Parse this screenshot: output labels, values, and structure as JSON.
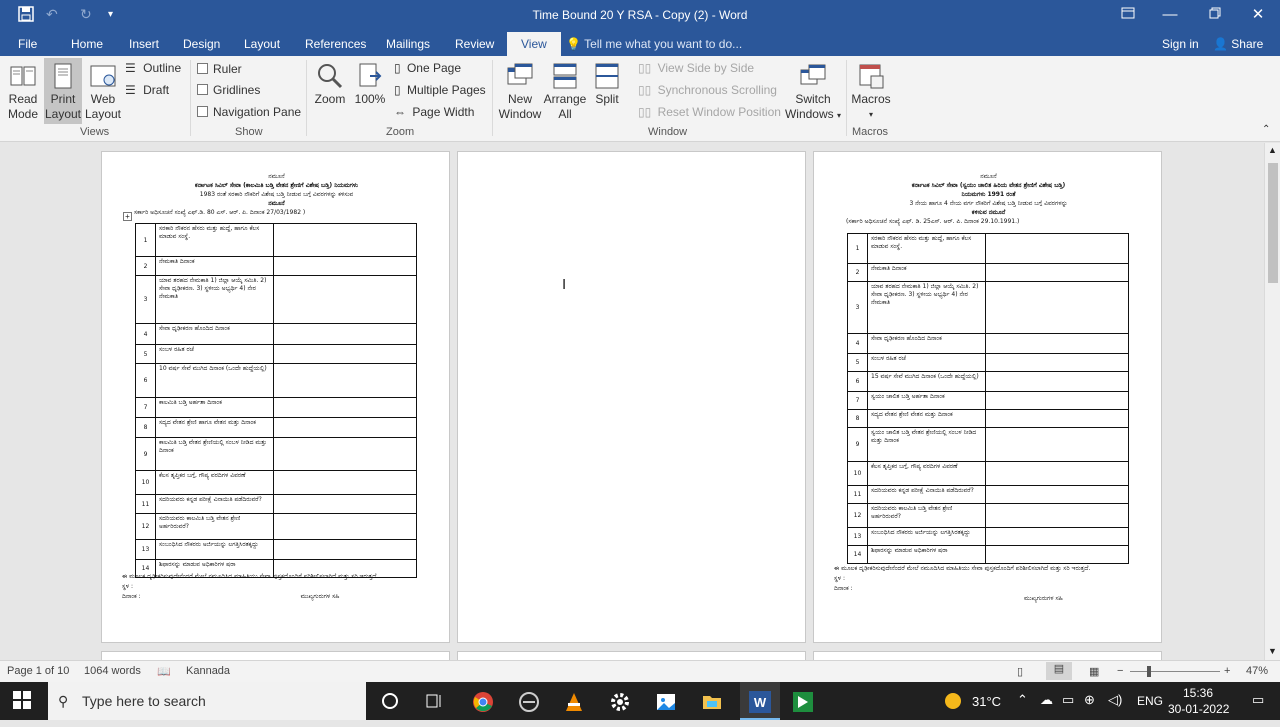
{
  "window": {
    "title": "Time Bound  20 Y RSA - Copy (2) - Word",
    "controls": [
      "restore-ribbon",
      "minimize",
      "maximize",
      "close"
    ]
  },
  "tabs": [
    "File",
    "Home",
    "Insert",
    "Design",
    "Layout",
    "References",
    "Mailings",
    "Review",
    "View"
  ],
  "active_tab": "View",
  "tell_me": "Tell me what you want to do...",
  "signin": "Sign in",
  "share": "Share",
  "ribbon": {
    "views": {
      "read_mode": [
        "Read",
        "Mode"
      ],
      "print_layout": [
        "Print",
        "Layout"
      ],
      "web_layout": [
        "Web",
        "Layout"
      ],
      "outline": "Outline",
      "draft": "Draft",
      "group": "Views"
    },
    "show": {
      "ruler": "Ruler",
      "gridlines": "Gridlines",
      "nav_pane": "Navigation Pane",
      "group": "Show"
    },
    "zoom": {
      "zoom": "Zoom",
      "pct": "100%",
      "one_page": "One Page",
      "multiple_pages": "Multiple Pages",
      "page_width": "Page Width",
      "group": "Zoom"
    },
    "window": {
      "new_window": [
        "New",
        "Window"
      ],
      "arrange_all": [
        "Arrange",
        "All"
      ],
      "split": "Split",
      "side_by_side": "View Side by Side",
      "sync_scroll": "Synchronous Scrolling",
      "reset_pos": "Reset Window Position",
      "switch_windows": [
        "Switch",
        "Windows"
      ],
      "group": "Window"
    },
    "macros": {
      "label": "Macros",
      "group": "Macros"
    }
  },
  "page1": {
    "lines": [
      "ನಮೂನೆ",
      "ಕರ್ನಾಟಕ ಸಿವಿಲ್ ಸೇವಾ (ಕಾಲಮಿತಿ ಬಡ್ತಿ ವೇತನ ಶ್ರೇಣಿಗೆ ವಿಶೇಷ ಬಡ್ತಿ) ನಿಯಮಗಳು",
      "1983 ರಂತೆ ಸರಕಾರಿ ನೌಕರಿಗೆ ವಿಶೇಷ ಬಡ್ತಿ ನೀಡುವ ಬಗ್ಗೆ ವಿವರಗಳನ್ನು ಕಳಿಸುವ",
      "ನಮೂನೆ",
      "ಸರ್ಕಾರಿ ಅಧಿಸೂಚನೆ ಸಂಖ್ಯೆ ಎಫ್.ಡಿ. 80 ಎಸ್. ಆರ್. ಪಿ. ದಿನಾಂಕ 27/03/1982 )"
    ],
    "rows": [
      "ಸರಕಾರಿ ನೌಕರನ ಹೆಸರು ಮತ್ತು ಹುದ್ದೆ, ಹಾಗೂ ಕೆಲಸ ಮಾಡುವ ಸಂಸ್ಥೆ.",
      "ನೇಮಕಾತಿ ದಿನಾಂಕ",
      "ಯಾವ ತರಹದ ನೇಮಕಾತಿ 1) ಜಿಲ್ಲಾ ಆಯ್ಕೆ ಸಮಿತಿ. 2) ಸೇವಾ ಧೃಢೀಕರಣ. 3) ಸ್ಥಳೀಯ ಅಭ್ಯರ್ಥಿ 4) ನೇರ ನೇಮಕಾತಿ",
      "ಸೇವಾ ಧೃಢೀಕರಣ ಹೊಂದಿದ ದಿನಾಂಕ",
      "ಸಂಬಳ ರಹಿತ ರಜೆ",
      "10 ವರ್ಷ ಸೇವೆ ಮುಗಿದ ದಿನಾಂಕ (ಒಂದೇ ಹುದ್ದೆಯಲ್ಲಿ)",
      "ಕಾಲಮಿತಿ ಬಡ್ತಿ ಅರ್ಹತಾ ದಿನಾಂಕ",
      "ಸದ್ಯದ ವೇತನ ಶ್ರೇಣಿ ಹಾಗೂ ವೇತನ ಮತ್ತು ದಿನಾಂಕ",
      "ಕಾಲಮಿತಿ ಬಡ್ತಿ ವೇತನ ಶ್ರೇಣಿಯಲ್ಲಿ ಸಂಬಳ ನೀಡಿದ ಮತ್ತು ದಿನಾಂಕ",
      "ಕೆಲಸ ತೃಪ್ತಿಕರ ಬಗ್ಗೆ, ಗೌಪ್ಯ ವರದಿಗಳ ವಿವರಣೆ",
      "ಸದರಿಯವರು ಕನ್ನಡ ಪರೀಕ್ಷೆ ವಿನಾಯಿತಿ ಪಡೆದಿರುವರೆ?",
      "ಸದರಿಯವರು ಕಾಲಮಿತಿ ಬಡ್ತಿ ವೇತನ ಶ್ರೇಣಿ ಅರ್ಹರಿರುವರೆ?",
      "ಸಂಬಂಧಿಸಿದ ನೌಕರರು ಅರ್ಜಿಯನ್ನು ಲಗತ್ತಿಸಿರತಕ್ಕದ್ದು",
      "ಶಿಫಾರಸನ್ನು ಮಾಡುವ ಅಧಿಕಾರಿಗಳ ಷರಾ"
    ],
    "footer": "ಈ ಮೂಲಕ ದೃಢೀಕರಿಸುವುದೇನೆಂದರೆ ಮೇಲೆ ನಮೂದಿಸಿದ ಮಾಹಿತಿಯು ಸೇವಾ ಪುಸ್ತಕದೊಂದಿಗೆ ಪರಿಶೀಲಿಸಲಾಗಿದೆ ಮತ್ತು ಸರಿ ಇರುತ್ತದೆ.",
    "place": "ಸ್ಥಳ :",
    "date": "ದಿನಾಂಕ :",
    "sign": "ಮುಖ್ಯಗುರುಗಳ ಸಹಿ"
  },
  "page3": {
    "lines": [
      "ನಮೂನೆ",
      "ಕರ್ನಾಟಕ ಸಿವಿಲ್ ಸೇವಾ (ಸ್ವಯಂ ಚಾಲಿತ ಹಿರಿಯ ವೇತನ ಶ್ರೇಣಿಗೆ ವಿಶೇಷ ಬಡ್ತಿ)",
      "ನಿಯಮಗಳು 1991 ರಂತೆ",
      "3 ನೇಯ ಹಾಗೂ 4 ನೇಯ ವರ್ಗ ನೌಕರಿಗೆ ವಿಶೇಷ ಬಡ್ತಿ ನೀಡುವ ಬಗ್ಗೆ ವಿವರಗಳನ್ನು",
      "ಕಳಿಸುವ ನಮೂನೆ",
      "(ಸರ್ಕಾರಿ ಅಧಿಸೂಚನೆ ಸಂಖ್ಯೆ ಎಫ್. ಡಿ. 25ಎಸ್. ಆರ್. ಪಿ. ದಿನಾಂಕ 29.10.1991.)"
    ],
    "rows": [
      "ಸರಕಾರಿ ನೌಕರನ ಹೆಸರು ಮತ್ತು ಹುದ್ದೆ, ಹಾಗೂ ಕೆಲಸ ಮಾಡುವ ಸಂಸ್ಥೆ.",
      "ನೇಮಕಾತಿ ದಿನಾಂಕ",
      "ಯಾವ ತರಹದ ನೇಮಕಾತಿ 1) ಜಿಲ್ಲಾ ಆಯ್ಕೆ ಸಮಿತಿ. 2) ಸೇವಾ ಧೃಢೀಕರಣ. 3) ಸ್ಥಳೀಯ ಅಭ್ಯರ್ಥಿ 4) ನೇರ ನೇಮಕಾತಿ",
      "ಸೇವಾ ಧೃಢೀಕರಣ ಹೊಂದಿದ ದಿನಾಂಕ",
      "ಸಂಬಳ ರಹಿತ ರಜೆ",
      "15 ವರ್ಷ ಸೇವೆ ಮುಗಿದ ದಿನಾಂಕ (ಒಂದೇ ಹುದ್ದೆಯಲ್ಲಿ)",
      "ಸ್ವಯಂ ಚಾಲಿತ ಬಡ್ತಿ ಅರ್ಹತಾ ದಿನಾಂಕ",
      "ಸದ್ಯದ ವೇತನ ಶ್ರೇಣಿ ವೇತನ ಮತ್ತು ದಿನಾಂಕ",
      "ಸ್ವಯಂ ಚಾಲಿತ ಬಡ್ತಿ ವೇತನ ಶ್ರೇಣಿಯಲ್ಲಿ ಸಂಬಳ ನೀಡಿದ ಮತ್ತು ದಿನಾಂಕ",
      "ಕೆಲಸ ತೃಪ್ತಿಕರ ಬಗ್ಗೆ, ಗೌಪ್ಯ ವರದಿಗಳ ವಿವರಣೆ",
      "ಸದರಿಯವರು ಕನ್ನಡ ಪರೀಕ್ಷೆ ವಿನಾಯಿತಿ ಪಡೆದಿರುವರೆ?",
      "ಸದರಿಯವರು ಕಾಲಮಿತಿ ಬಡ್ತಿ ವೇತನ ಶ್ರೇಣಿ ಅರ್ಹರಿರುವರೆ?",
      "ಸಂಬಂಧಿಸಿದ ನೌಕರರು ಅರ್ಜಿಯನ್ನು ಲಗತ್ತಿಸಿರತಕ್ಕದ್ದು",
      "ಶಿಫಾರಸನ್ನು ಮಾಡುವ ಅಧಿಕಾರಿಗಳ ಷರಾ"
    ],
    "footer": "ಈ ಮೂಲಕ ದೃಢೀಕರಿಸುವುದೇನೆಂದರೆ ಮೇಲೆ ನಮೂದಿಸಿದ ಮಾಹಿತಿಯು ಸೇವಾ ಪುಸ್ತಕದೊಂದಿಗೆ ಪರಿಶೀಲಿಸಲಾಗಿದೆ ಮತ್ತು ಸರಿ ಇರುತ್ತದೆ.",
    "place": "ಸ್ಥಳ :",
    "date": "ದಿನಾಂಕ :",
    "sign": "ಮುಖ್ಯಗುರುಗಳ ಸಹಿ"
  },
  "status": {
    "page": "Page 1 of 10",
    "words": "1064 words",
    "language": "Kannada",
    "zoom": "47%",
    "zoom_fraction": 0.47
  },
  "taskbar": {
    "search_placeholder": "Type here to search",
    "weather": "31°C",
    "lang": "ENG",
    "time": "15:36",
    "date": "30-01-2022"
  },
  "colors": {
    "word_blue": "#2b579a",
    "taskbar": "#202020",
    "ribbon": "#f3f3f3"
  }
}
